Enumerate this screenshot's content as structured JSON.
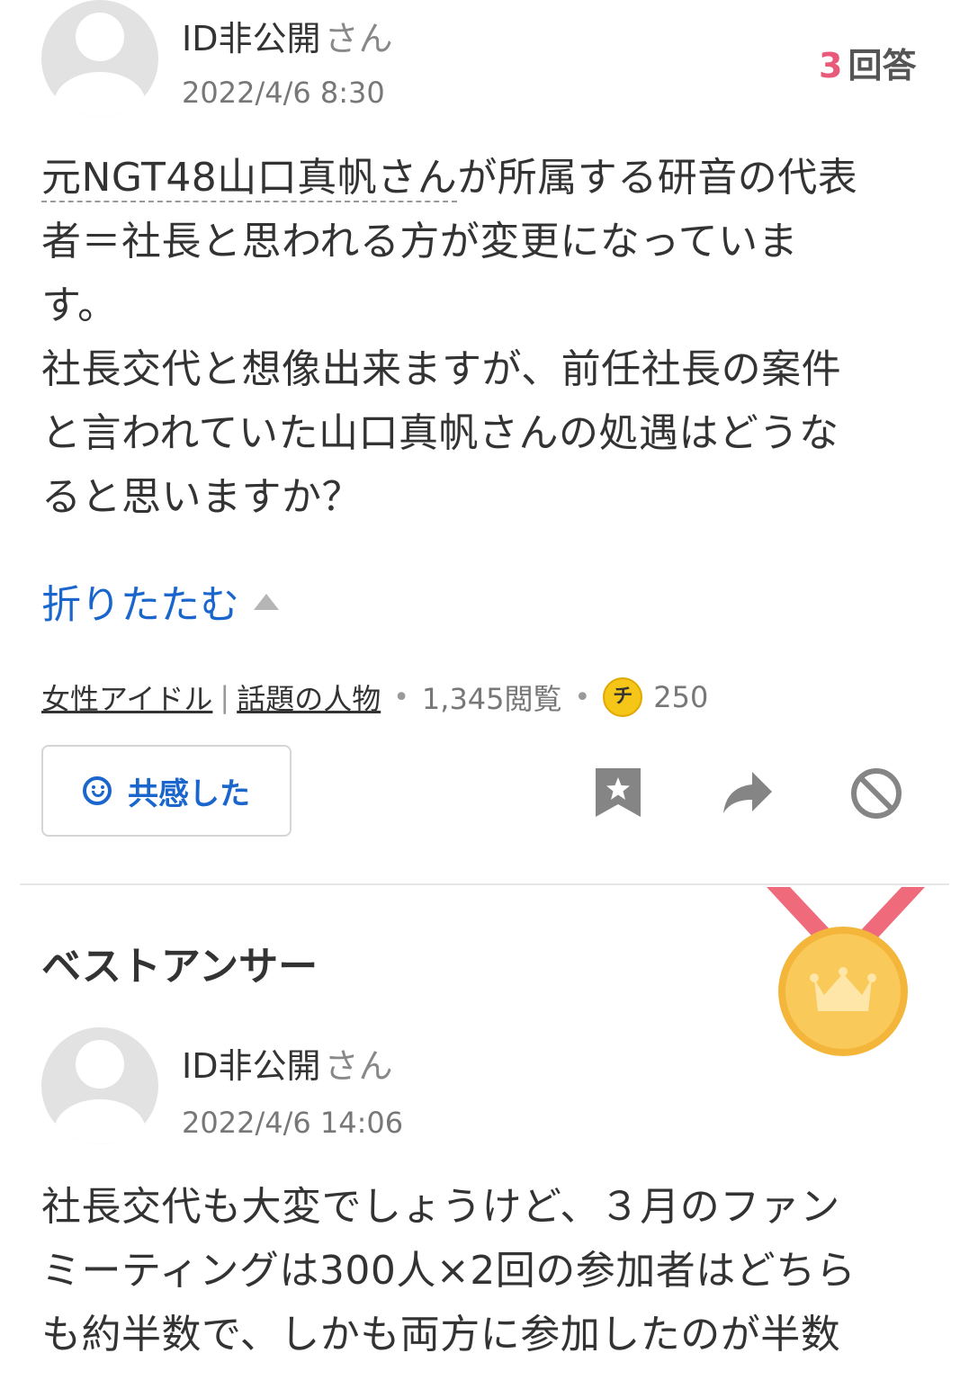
{
  "question": {
    "user_name": "ID非公開",
    "user_suffix": "さん",
    "date": "2022/4/6 8:30",
    "answer_count_num": "3",
    "answer_count_label": "回答",
    "body_link_text": "元NGT48山口真帆さん",
    "body_after_link": "が所属する研音の代表",
    "body_rest": "者＝社長と思われる方が変更になっていま\nす。\n社長交代と想像出来ますが、前任社長の案件\nと言われていた山口真帆さんの処遇はどうな\nると思いますか？",
    "collapse_label": "折りたたむ",
    "category1": "女性アイドル",
    "category_sep": "|",
    "category2": "話題の人物",
    "views": "1,345閲覧",
    "coin_symbol": "チ",
    "coins": "250",
    "empathy_label": "共感した"
  },
  "best_answer": {
    "title": "ベストアンサー",
    "user_name": "ID非公開",
    "user_suffix": "さん",
    "date": "2022/4/6 14:06",
    "body": "社長交代も大変でしょうけど、３月のファン\nミーティングは300人×2回の参加者はどちら\nも約半数で、しかも両方に参加したのが半数"
  },
  "icons": [
    "user-avatar-icon",
    "smile-icon",
    "bookmark-icon",
    "share-icon",
    "block-icon",
    "medal-icon",
    "crown-icon"
  ],
  "colors": {
    "accent_blue": "#1a66cc",
    "count_pink": "#e8597a",
    "medal_gold": "#f9c64a",
    "ribbon_red": "#ef6b7c"
  }
}
